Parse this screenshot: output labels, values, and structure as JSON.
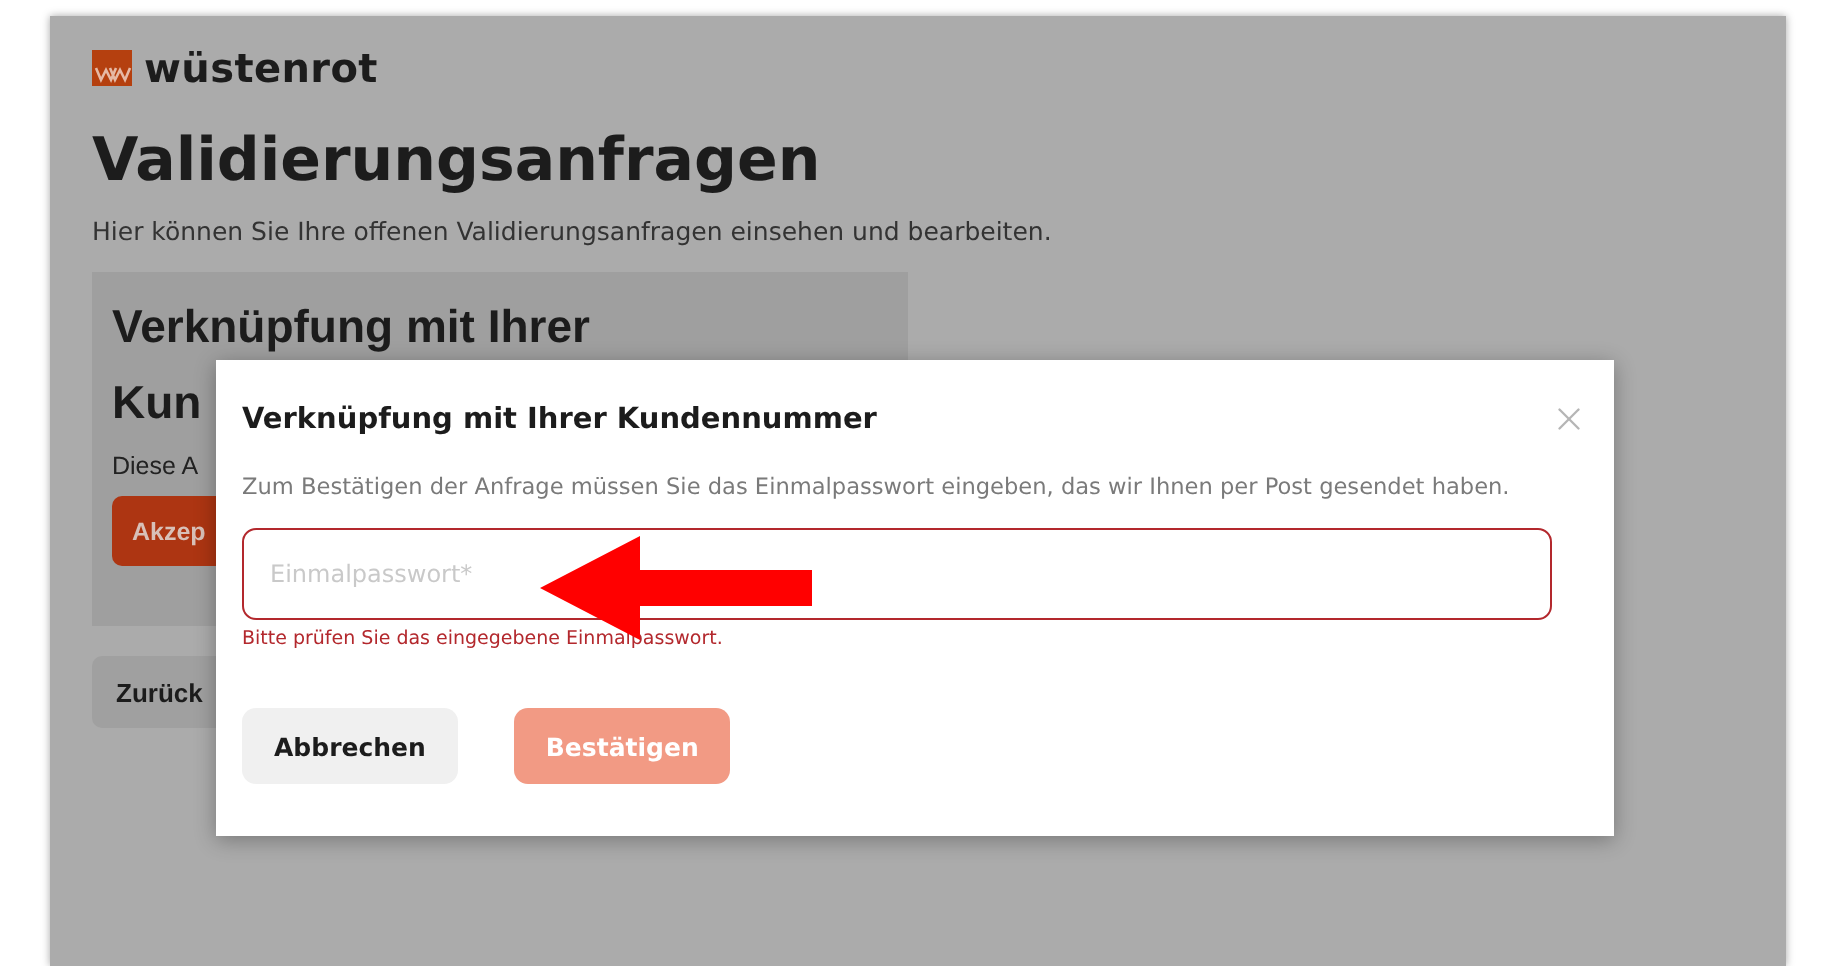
{
  "logo": {
    "text": "wüstenrot"
  },
  "page": {
    "title": "Validierungsanfragen",
    "subtitle": "Hier können Sie Ihre offenen Validierungsanfragen einsehen und bearbeiten."
  },
  "card": {
    "title_lines": [
      "Verknüpfung mit Ihrer",
      "Kun"
    ],
    "text": "Diese A",
    "accept_button": "Akzep"
  },
  "back_button": "Zurück",
  "dialog": {
    "title": "Verknüpfung mit Ihrer Kundennummer",
    "description": "Zum Bestätigen der Anfrage müssen Sie das Einmalpasswort eingeben, das wir Ihnen per Post gesendet haben.",
    "field": {
      "placeholder": "Einmalpasswort*",
      "invalid": true
    },
    "error": "Bitte prüfen Sie das eingegebene Einmalpasswort.",
    "buttons": [
      {
        "label": "Abbrechen",
        "kind": "secondary",
        "disabled": false
      },
      {
        "label": "Bestätigen",
        "kind": "primary",
        "disabled": true
      }
    ]
  }
}
